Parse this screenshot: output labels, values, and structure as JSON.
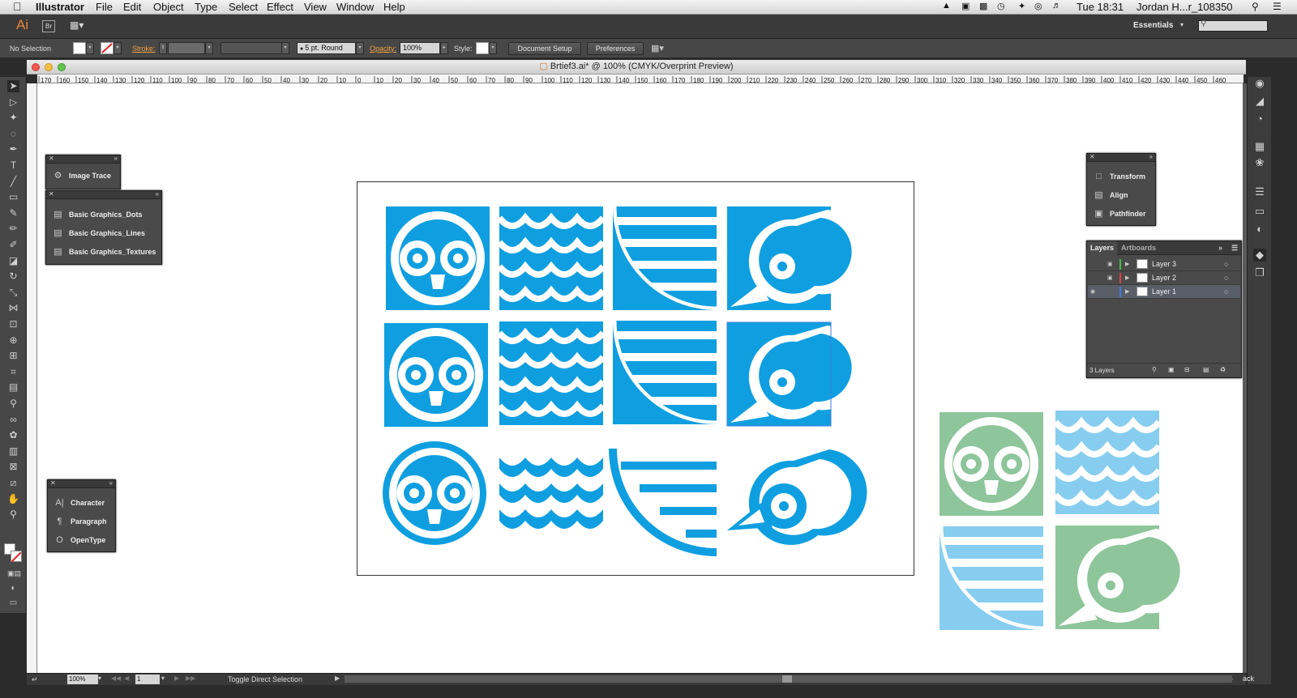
{
  "menubar": {
    "app_name": "Illustrator",
    "menus": [
      "File",
      "Edit",
      "Object",
      "Type",
      "Select",
      "Effect",
      "View",
      "Window",
      "Help"
    ],
    "clock": "Tue 18:31",
    "user": "Jordan H...r_108350"
  },
  "appbar": {
    "logo": "Ai",
    "bridge": "Br",
    "workspace": "Essentials"
  },
  "control": {
    "selection": "No Selection",
    "stroke_label": "Stroke:",
    "brush_value": "5 pt. Round",
    "opacity_label": "Opacity:",
    "opacity_value": "100%",
    "style_label": "Style:",
    "document_setup": "Document Setup",
    "preferences": "Preferences"
  },
  "document": {
    "title": "Brtief3.ai* @ 100% (CMYK/Overprint Preview)"
  },
  "ruler_ticks": [
    "170",
    "160",
    "150",
    "140",
    "130",
    "120",
    "110",
    "100",
    "90",
    "80",
    "70",
    "60",
    "50",
    "40",
    "30",
    "20",
    "10",
    "0",
    "10",
    "20",
    "30",
    "40",
    "50",
    "60",
    "70",
    "80",
    "90",
    "100",
    "110",
    "120",
    "130",
    "140",
    "150",
    "160",
    "170",
    "180",
    "190",
    "200",
    "210",
    "220",
    "230",
    "240",
    "250",
    "260",
    "270",
    "280",
    "290",
    "300",
    "310",
    "320",
    "330",
    "340",
    "350",
    "360",
    "370",
    "380",
    "390",
    "400",
    "410",
    "420",
    "430",
    "440",
    "450",
    "460"
  ],
  "panels": {
    "image_trace": "Image Trace",
    "graphics": [
      "Basic Graphics_Dots",
      "Basic Graphics_Lines",
      "Basic Graphics_Textures"
    ],
    "type": [
      "Character",
      "Paragraph",
      "OpenType"
    ],
    "transform": [
      "Transform",
      "Align",
      "Pathfinder"
    ]
  },
  "layers_panel": {
    "tabs": [
      "Layers",
      "Artboards"
    ],
    "layers": [
      "Layer 3",
      "Layer 2",
      "Layer 1"
    ],
    "layer_colors": [
      "#3ec43e",
      "#e04040",
      "#3c7de0"
    ],
    "count": "3 Layers"
  },
  "status": {
    "zoom": "100%",
    "artboard_number": "1",
    "tool_hint": "Toggle Direct Selection",
    "corner": "ack"
  },
  "colors": {
    "art_blue": "#0f9fe0",
    "art_green": "#8ec59b",
    "art_lightblue": "#87cdf0"
  },
  "tools": [
    "selection-tool",
    "direct-selection-tool",
    "magic-wand-tool",
    "lasso-tool",
    "pen-tool",
    "type-tool",
    "line-tool",
    "rectangle-tool",
    "paintbrush-tool",
    "pencil-tool",
    "blob-brush-tool",
    "eraser-tool",
    "rotate-tool",
    "scale-tool",
    "width-tool",
    "free-transform-tool",
    "shape-builder-tool",
    "perspective-grid-tool",
    "mesh-tool",
    "gradient-tool",
    "eyedropper-tool",
    "blend-tool",
    "symbol-sprayer-tool",
    "column-graph-tool",
    "artboard-tool",
    "slice-tool",
    "hand-tool",
    "zoom-tool"
  ]
}
